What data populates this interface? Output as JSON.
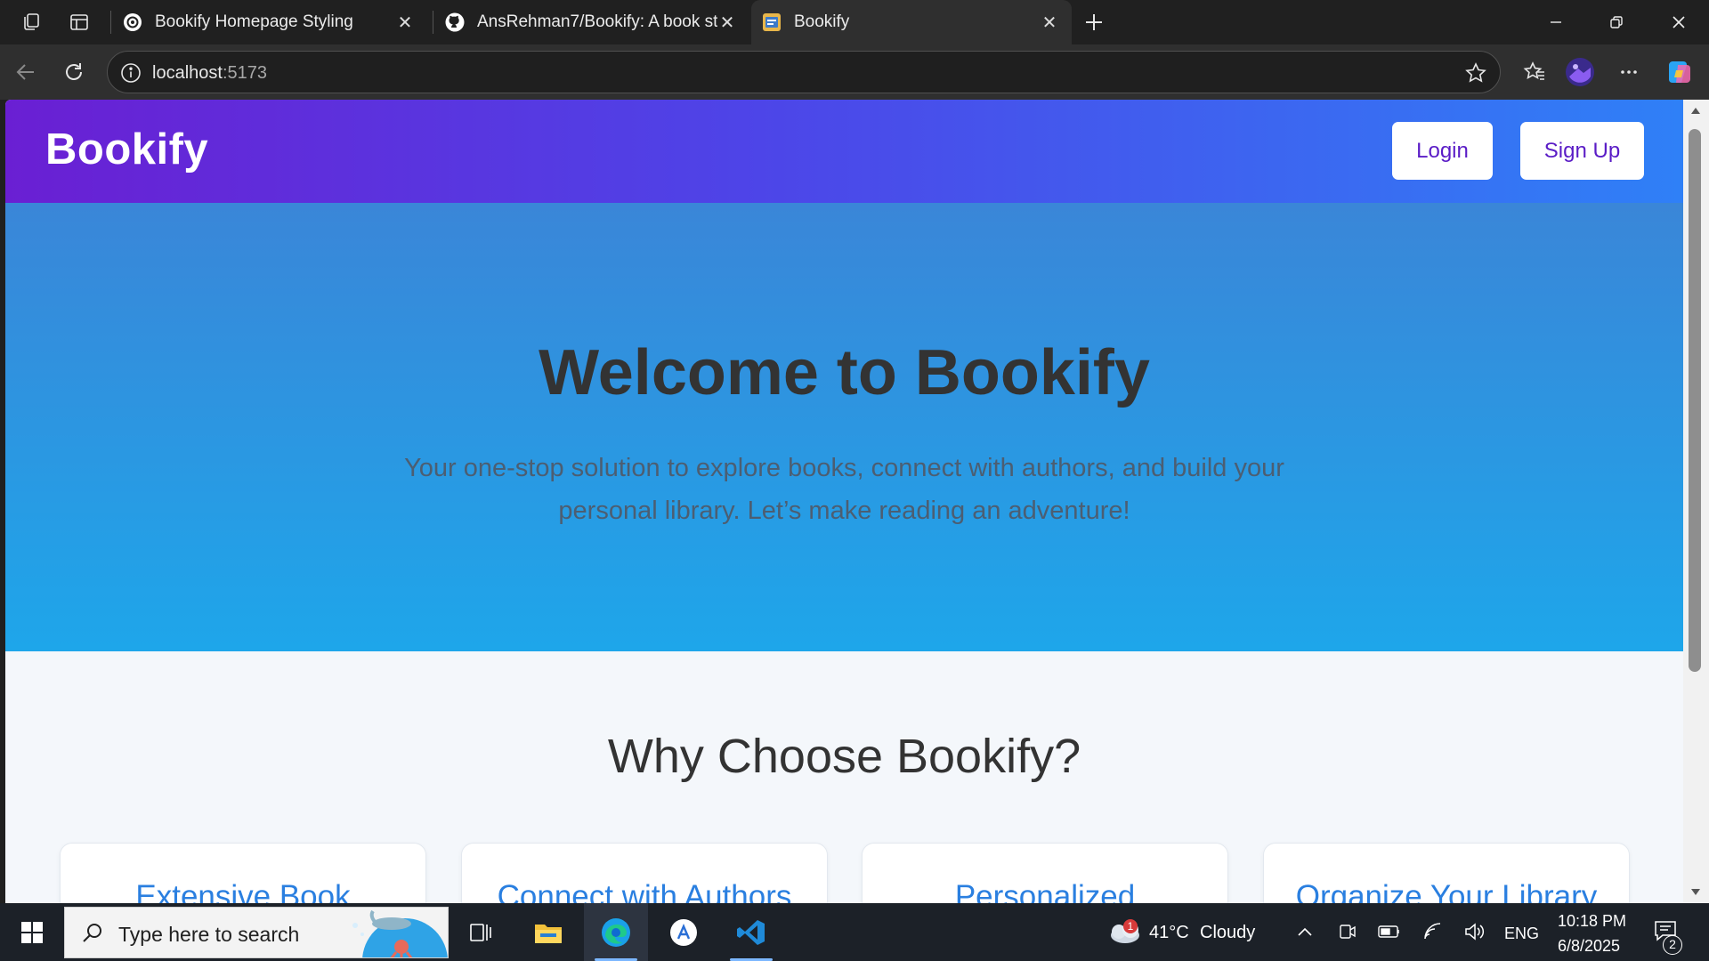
{
  "browser": {
    "tabs": [
      {
        "title": "Bookify Homepage Styling",
        "icon": "openai-icon",
        "active": false
      },
      {
        "title": "AnsRehman7/Bookify: A book sto",
        "icon": "github-icon",
        "active": false
      },
      {
        "title": "Bookify",
        "icon": "bookify-favicon",
        "active": true
      }
    ],
    "url_host": "localhost",
    "url_port": ":5173"
  },
  "site": {
    "logo": "Bookify",
    "nav": {
      "login": "Login",
      "signup": "Sign Up"
    },
    "hero": {
      "title": "Welcome to Bookify",
      "subtitle": "Your one-stop solution to explore books, connect with authors, and build your personal library. Let’s make reading an adventure!"
    },
    "features": {
      "title": "Why Choose Bookify?",
      "cards": [
        {
          "title": "Extensive Book"
        },
        {
          "title": "Connect with Authors"
        },
        {
          "title": "Personalized"
        },
        {
          "title": "Organize Your Library"
        }
      ]
    },
    "colors": {
      "nav_start": "#6a1fd3",
      "nav_end": "#2f80f7",
      "hero_top": "#3a86d8",
      "hero_bottom": "#1ea6ea",
      "accent": "#2a7fe0"
    }
  },
  "taskbar": {
    "search_placeholder": "Type here to search",
    "weather_temp": "41°C",
    "weather_desc": "Cloudy",
    "weather_badge": "1",
    "language": "ENG",
    "time": "10:18 PM",
    "date": "6/8/2025",
    "notification_count": "2"
  }
}
